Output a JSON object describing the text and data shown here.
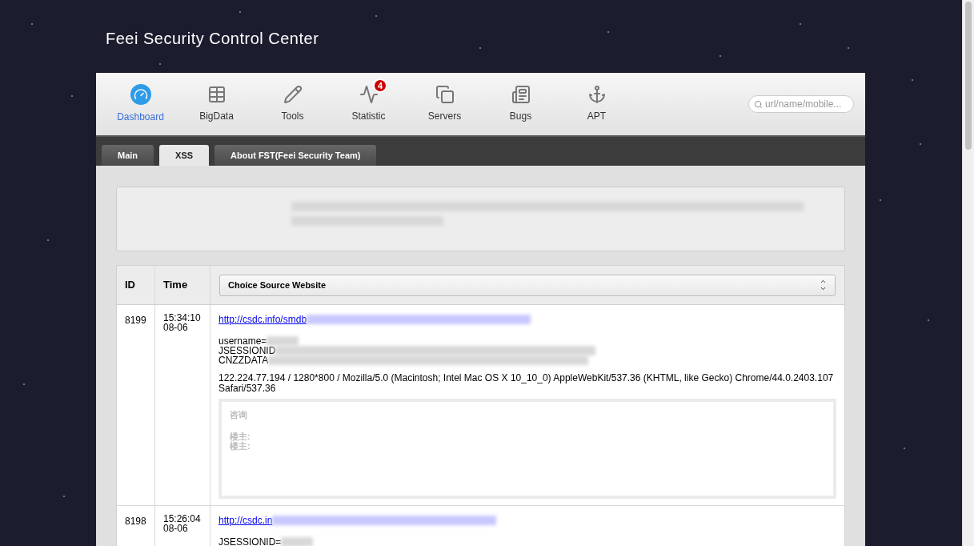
{
  "site_title": "Feei Security Control Center",
  "nav": [
    {
      "label": "Dashboard",
      "kind": "gauge",
      "selected": true
    },
    {
      "label": "BigData",
      "kind": "table",
      "selected": false
    },
    {
      "label": "Tools",
      "kind": "pencil",
      "selected": false
    },
    {
      "label": "Statistic",
      "kind": "pulse",
      "selected": false,
      "badge": "4"
    },
    {
      "label": "Servers",
      "kind": "copies",
      "selected": false
    },
    {
      "label": "Bugs",
      "kind": "news",
      "selected": false
    },
    {
      "label": "APT",
      "kind": "anchor",
      "selected": false
    }
  ],
  "search": {
    "placeholder": "url/name/mobile..."
  },
  "tabs": [
    {
      "label": "Main",
      "selected": false
    },
    {
      "label": "XSS",
      "selected": true
    },
    {
      "label": "About FST(Feei Security Team)",
      "selected": false
    }
  ],
  "table": {
    "columns": [
      "ID",
      "Time"
    ],
    "source_select": "Choice Source Website",
    "rows": [
      {
        "id": "8199",
        "time": [
          "15:34:10",
          "08-06"
        ],
        "link": "http://csdc.info/smdb",
        "fields": [
          "username=",
          "JSESSIONID",
          "CNZZDATA"
        ],
        "agent": "122.224.77.194 / 1280*800 / Mozilla/5.0 (Macintosh; Intel Mac OS X 10_10_0) AppleWebKit/537.36 (KHTML, like Gecko) Chrome/44.0.2403.107 Safari/537.36",
        "preview": {
          "title": "咨询",
          "lines": [
            "楼主:",
            "楼主:"
          ]
        }
      },
      {
        "id": "8198",
        "time": [
          "15:26:04",
          "08-06"
        ],
        "link": "http://csdc.in",
        "fields": [
          "JSESSIONID="
        ]
      }
    ]
  }
}
